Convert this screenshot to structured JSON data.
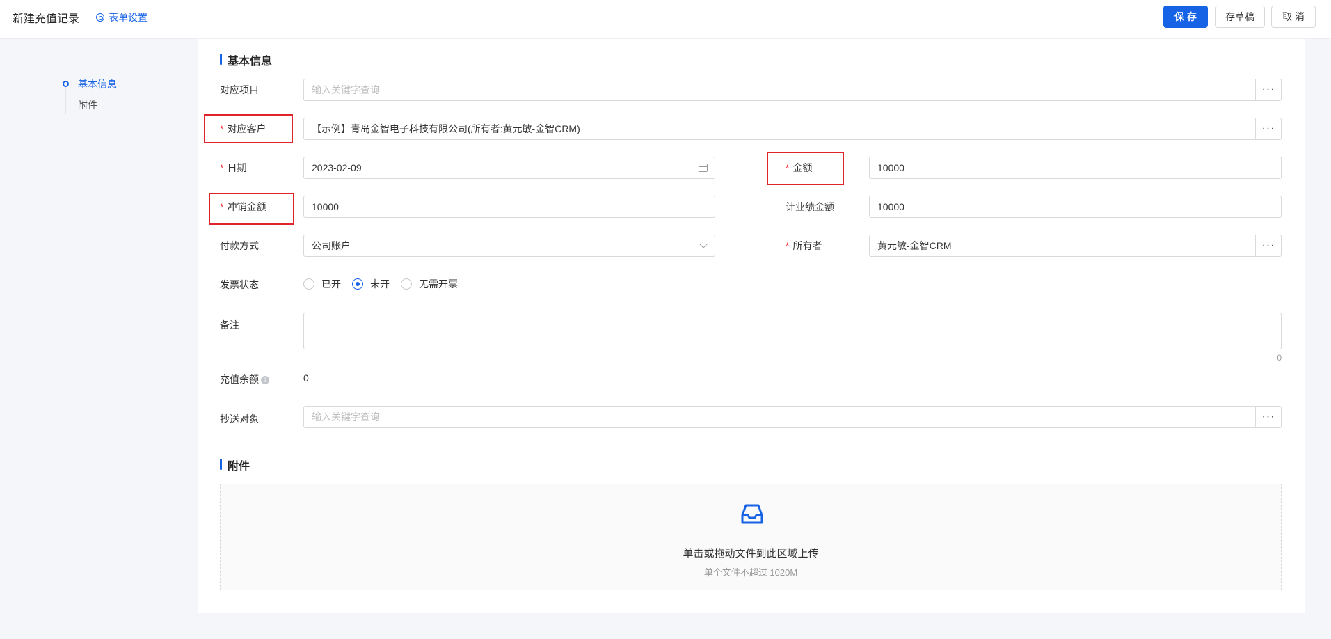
{
  "header": {
    "title": "新建充值记录",
    "form_settings": "表单设置",
    "save": "保 存",
    "draft": "存草稿",
    "cancel": "取 消"
  },
  "nav": {
    "items": [
      {
        "label": "基本信息",
        "active": true
      },
      {
        "label": "附件",
        "active": false
      }
    ]
  },
  "sections": {
    "basic": "基本信息",
    "attachments": "附件"
  },
  "fields": {
    "project": {
      "label": "对应项目",
      "placeholder": "输入关键字查询"
    },
    "customer": {
      "label": "对应客户",
      "value": "【示例】青岛金智电子科技有限公司(所有者:黄元敏-金智CRM)"
    },
    "date": {
      "label": "日期",
      "value": "2023-02-09"
    },
    "amount": {
      "label": "金额",
      "value": "10000"
    },
    "writeoff": {
      "label": "冲销金额",
      "value": "10000"
    },
    "performance": {
      "label": "计业绩金额",
      "value": "10000"
    },
    "payment": {
      "label": "付款方式",
      "value": "公司账户"
    },
    "owner": {
      "label": "所有者",
      "value": "黄元敏-金智CRM"
    },
    "invoice": {
      "label": "发票状态",
      "options": [
        "已开",
        "未开",
        "无需开票"
      ],
      "selected": "未开"
    },
    "remark": {
      "label": "备注",
      "count": "0"
    },
    "balance": {
      "label": "充值余额",
      "value": "0"
    },
    "cc": {
      "label": "抄送对象",
      "placeholder": "输入关键字查询"
    }
  },
  "required_mark": "*",
  "more_label": "···",
  "help_glyph": "?",
  "upload": {
    "main": "单击或拖动文件到此区域上传",
    "sub": "单个文件不超过 1020M"
  },
  "colors": {
    "primary": "#1763e6",
    "required": "#f5222d",
    "highlight_box": "#e0242c"
  }
}
